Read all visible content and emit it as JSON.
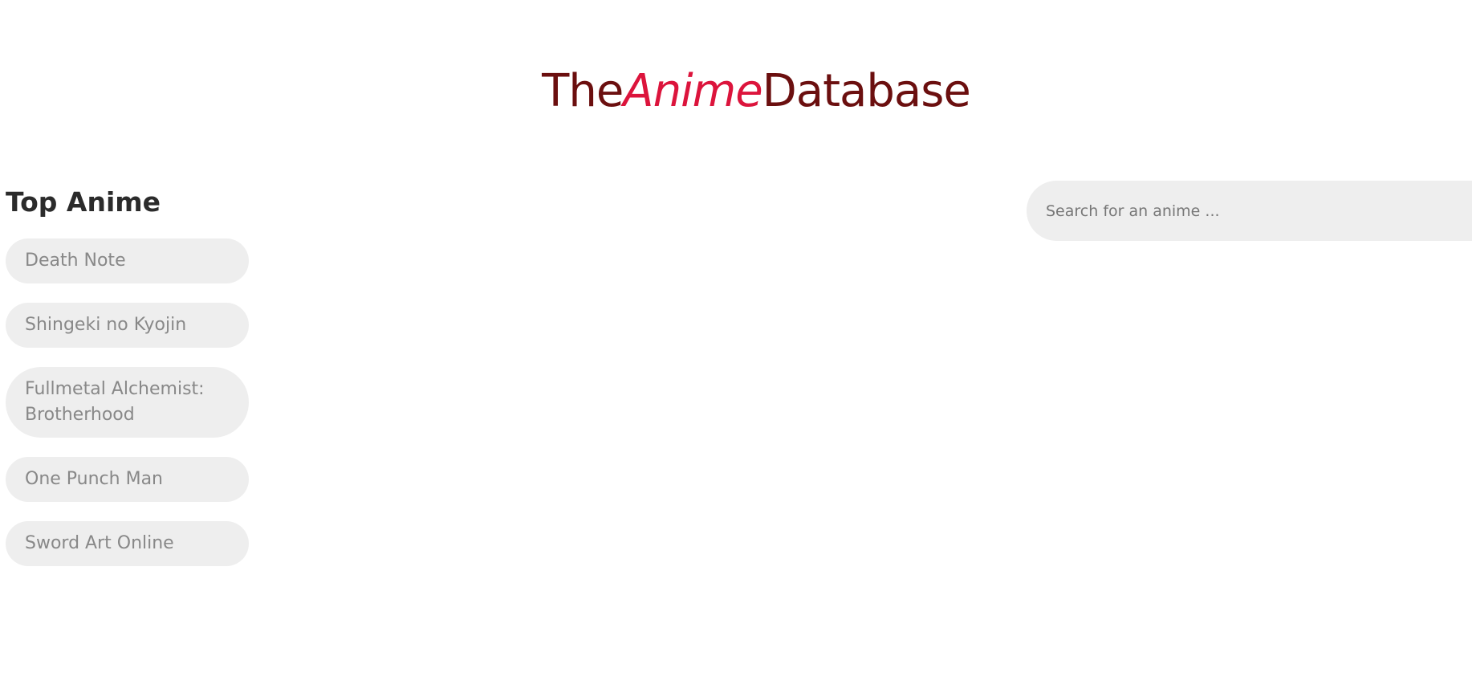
{
  "logo": {
    "part1": "The",
    "part2": "Anime",
    "part3": "Database",
    "colors": {
      "dark": "#6b0f0f",
      "accent": "#dc143c"
    }
  },
  "sidebar": {
    "heading": "Top Anime",
    "items": [
      {
        "label": "Death Note"
      },
      {
        "label": "Shingeki no Kyojin"
      },
      {
        "label": "Fullmetal Alchemist: Brotherhood"
      },
      {
        "label": "One Punch Man"
      },
      {
        "label": "Sword Art Online"
      }
    ]
  },
  "search": {
    "placeholder": "Search for an anime ...",
    "value": ""
  }
}
